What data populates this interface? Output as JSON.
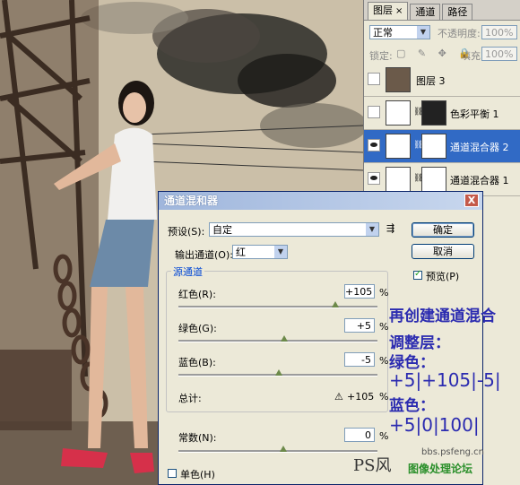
{
  "layers_panel": {
    "tabs": [
      {
        "label": "图层",
        "close": "×"
      },
      {
        "label": "通道"
      },
      {
        "label": "路径"
      }
    ],
    "blend_mode": "正常",
    "opacity_label": "不透明度:",
    "opacity_value": "100%",
    "lock_label": "锁定:",
    "fill_label": "填充:",
    "fill_value": "100%",
    "layers": [
      {
        "name": "图层 3",
        "visible": false
      },
      {
        "name": "色彩平衡 1",
        "visible": false
      },
      {
        "name": "通道混合器 2",
        "visible": true,
        "selected": true
      },
      {
        "name": "通道混合器 1",
        "visible": true
      }
    ]
  },
  "dialog": {
    "title": "通道混和器",
    "close": "X",
    "preset_label": "预设(S):",
    "preset_value": "自定",
    "output_label": "输出通道(O):",
    "output_value": "红",
    "ok_label": "确定",
    "cancel_label": "取消",
    "preview_label": "预览(P)",
    "preview_checked": true,
    "source_group_label": "源通道",
    "red_label": "红色(R):",
    "red_value": "+105",
    "green_label": "绿色(G):",
    "green_value": "+5",
    "blue_label": "蓝色(B):",
    "blue_value": "-5",
    "total_label": "总计:",
    "total_value": "+105",
    "percent": "%",
    "constant_label": "常数(N):",
    "constant_value": "0",
    "mono_label": "单色(H)",
    "mono_checked": false
  },
  "annotation": {
    "line1": "再创建通道混合",
    "line2": "调整层：",
    "line3": "绿色：",
    "line4": "+5|+105|-5|",
    "line5": "蓝色：",
    "line6": "+5|0|100|"
  },
  "watermark": {
    "site": "bbs.psfeng.cn",
    "logo_text": "PS风",
    "forum": "图像处理论坛"
  },
  "colors": {
    "selection": "#316ac5",
    "annotation": "#2b2bb0"
  }
}
